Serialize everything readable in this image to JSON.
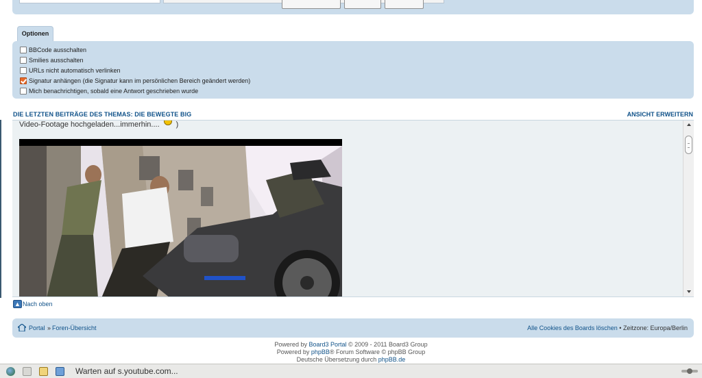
{
  "options": {
    "tab_label": "Optionen",
    "items": [
      {
        "label": "BBCode ausschalten",
        "checked": false
      },
      {
        "label": "Smilies ausschalten",
        "checked": false
      },
      {
        "label": "URLs nicht automatisch verlinken",
        "checked": false
      },
      {
        "label": "Signatur anhängen (die Signatur kann im persönlichen Bereich geändert werden)",
        "checked": true
      },
      {
        "label": "Mich benachrichtigen, sobald eine Antwort geschrieben wurde",
        "checked": false
      }
    ]
  },
  "review": {
    "title": "DIE LETZTEN BEITRÄGE DES THEMAS: DIE BEWEGTE BIG",
    "expand_label": "ANSICHT ERWEITERN",
    "text_before": "Video-Footage hochgeladen...immerhin....",
    "text_after": ")"
  },
  "back_to_top": "Nach oben",
  "navbar": {
    "portal": "Portal",
    "separator": "»",
    "forum_index": "Foren-Übersicht",
    "delete_cookies": "Alle Cookies des Boards löschen",
    "bullet": "•",
    "timezone": "Zeitzone: Europa/Berlin"
  },
  "copyright": {
    "line1_prefix": "Powered by",
    "line1_link": "Board3 Portal",
    "line1_suffix": "© 2009 - 2011 Board3 Group",
    "line2_prefix": "Powered by",
    "line2_link": "phpBB",
    "line2_suffix": "® Forum Software © phpBB Group",
    "line3_prefix": "Deutsche Übersetzung durch",
    "line3_link": "phpBB.de"
  },
  "statusbar": {
    "text": "Warten auf s.youtube.com..."
  },
  "colors": {
    "panel_bg": "#cadceb",
    "link": "#105289",
    "checkbox_checked": "#e86a2a"
  }
}
